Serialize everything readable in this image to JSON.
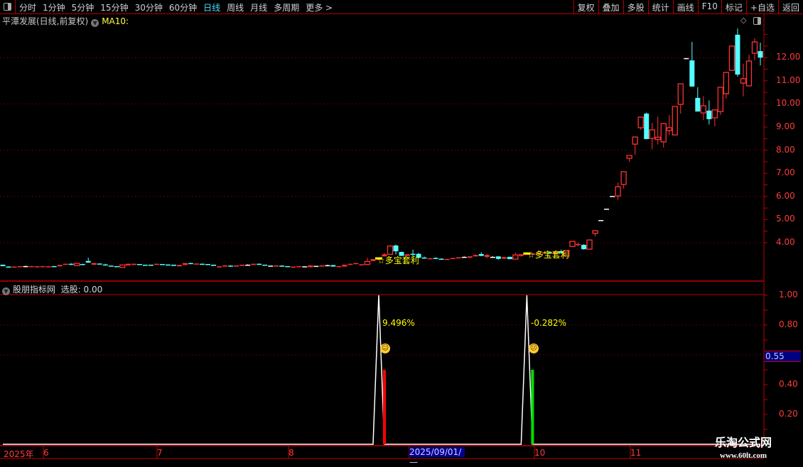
{
  "toolbar": {
    "periods": [
      "分时",
      "1分钟",
      "5分钟",
      "15分钟",
      "30分钟",
      "60分钟",
      "日线",
      "周线",
      "月线",
      "多周期",
      "更多 >"
    ],
    "active_period": "日线",
    "right_buttons": [
      "复权",
      "叠加",
      "多股",
      "统计",
      "画线",
      "F10",
      "标记",
      "+自选",
      "返回"
    ]
  },
  "main": {
    "title": "平潭发展(日线,前复权)",
    "ma_label": "MA10:",
    "price_labels": [
      "12.00",
      "11.00",
      "10.00",
      "9.00",
      "8.00",
      "7.00",
      "6.00",
      "5.00",
      "4.00"
    ],
    "annotations": [
      "☆多宝套利",
      "☆多宝套利"
    ]
  },
  "indicator": {
    "name": "股朋指标网",
    "select_label": "选股: 0.00",
    "axis_labels": [
      "1.00",
      "0.80",
      "0.40",
      "0.20"
    ],
    "cursor_value": "0.55",
    "pct_labels": [
      "9.496%",
      "-0.282%"
    ],
    "signals": [
      {
        "index": 66,
        "bar_index": 67,
        "bar_value": 0.5,
        "color": "#ff0000",
        "mood": "happy"
      },
      {
        "index": 92,
        "bar_index": 93,
        "bar_value": 0.5,
        "color": "#00e000",
        "mood": "sad"
      }
    ]
  },
  "date_axis": {
    "labels": [
      "2025年",
      "6",
      "7",
      "8",
      "10",
      "11"
    ],
    "cursor_date": "2025/09/01/—"
  },
  "watermark": {
    "name": "乐淘公式网",
    "url": "www.60lt.com"
  },
  "colors": {
    "up": "#ff3232",
    "down": "#54ffff",
    "flat": "#ffffff",
    "axis": "#c00000",
    "annotation": "#ffff00"
  },
  "chart_data": {
    "type": "candlestick",
    "ylim": [
      2.8,
      13.3
    ],
    "ohlc_format": "open,close,high,low",
    "candles": [
      [
        3.05,
        2.99,
        3.06,
        2.98
      ],
      [
        2.97,
        2.96,
        2.98,
        2.95
      ],
      [
        2.93,
        2.97,
        2.97,
        2.93
      ],
      [
        2.95,
        2.99,
        2.99,
        2.95
      ],
      [
        2.99,
        2.99,
        3.01,
        2.98
      ],
      [
        2.95,
        2.99,
        2.99,
        2.95
      ],
      [
        2.97,
        2.98,
        2.98,
        2.97
      ],
      [
        2.95,
        2.99,
        2.99,
        2.95
      ],
      [
        2.97,
        2.98,
        2.98,
        2.97
      ],
      [
        2.99,
        2.98,
        2.99,
        2.98
      ],
      [
        2.98,
        3.04,
        3.04,
        2.98
      ],
      [
        3.05,
        3.09,
        3.09,
        3.05
      ],
      [
        3.09,
        3.05,
        3.11,
        3.03
      ],
      [
        3.01,
        3.11,
        3.11,
        3.01
      ],
      [
        3.08,
        3.07,
        3.09,
        3.07
      ],
      [
        3.21,
        3.14,
        3.35,
        3.14
      ],
      [
        3.05,
        3.12,
        3.12,
        3.05
      ],
      [
        3.1,
        3.08,
        3.1,
        3.08
      ],
      [
        3.06,
        3.05,
        3.09,
        3.02
      ],
      [
        3.01,
        3.0,
        3.01,
        3.0
      ],
      [
        2.99,
        2.98,
        2.99,
        2.98
      ],
      [
        2.93,
        3.04,
        3.04,
        2.93
      ],
      [
        3.02,
        3.09,
        3.09,
        3.02
      ],
      [
        3.04,
        3.09,
        3.09,
        3.04
      ],
      [
        3.08,
        3.07,
        3.08,
        3.07
      ],
      [
        3.05,
        3.04,
        3.05,
        3.04
      ],
      [
        3.05,
        3.04,
        3.05,
        3.04
      ],
      [
        3.05,
        3.09,
        3.09,
        3.05
      ],
      [
        3.08,
        3.07,
        3.08,
        3.07
      ],
      [
        3.06,
        3.05,
        3.06,
        3.05
      ],
      [
        3.05,
        3.0,
        3.05,
        3.0
      ],
      [
        2.98,
        3.04,
        3.04,
        2.98
      ],
      [
        3.04,
        3.12,
        3.12,
        3.04
      ],
      [
        3.12,
        3.11,
        3.14,
        3.1
      ],
      [
        3.06,
        3.1,
        3.1,
        3.06
      ],
      [
        3.09,
        3.08,
        3.1,
        3.06
      ],
      [
        3.08,
        3.07,
        3.08,
        3.07
      ],
      [
        3.05,
        3.0,
        3.05,
        3.0
      ],
      [
        2.97,
        2.98,
        2.98,
        2.97
      ],
      [
        2.97,
        3.02,
        3.02,
        2.97
      ],
      [
        3.01,
        3.0,
        3.03,
        3.0
      ],
      [
        2.97,
        3.02,
        3.02,
        2.97
      ],
      [
        3.0,
        3.05,
        3.05,
        3.0
      ],
      [
        3.05,
        3.05,
        3.07,
        3.04
      ],
      [
        3.04,
        3.09,
        3.09,
        3.04
      ],
      [
        3.09,
        3.08,
        3.1,
        3.06
      ],
      [
        3.05,
        3.04,
        3.05,
        3.04
      ],
      [
        3.01,
        3.01,
        3.01,
        3.01
      ],
      [
        2.97,
        3.02,
        3.02,
        2.97
      ],
      [
        3.01,
        3.0,
        3.03,
        3.0
      ],
      [
        2.99,
        2.98,
        2.99,
        2.98
      ],
      [
        2.96,
        2.97,
        2.97,
        2.96
      ],
      [
        2.95,
        2.99,
        2.99,
        2.95
      ],
      [
        2.98,
        2.98,
        2.98,
        2.98
      ],
      [
        2.94,
        3.02,
        3.02,
        2.94
      ],
      [
        3.0,
        3.0,
        3.0,
        3.0
      ],
      [
        2.97,
        3.02,
        3.02,
        2.97
      ],
      [
        3.03,
        3.03,
        3.05,
        3.02
      ],
      [
        3.03,
        2.97,
        3.05,
        2.97
      ],
      [
        2.95,
        2.99,
        2.99,
        2.95
      ],
      [
        2.97,
        3.05,
        3.05,
        2.97
      ],
      [
        3.05,
        3.09,
        3.09,
        3.05
      ],
      [
        3.08,
        3.12,
        3.12,
        3.08
      ],
      [
        3.04,
        3.07,
        3.07,
        3.04
      ],
      [
        3.06,
        3.19,
        3.35,
        3.06
      ],
      [
        3.21,
        3.29,
        3.29,
        3.21
      ],
      [
        3.28,
        3.31,
        3.32,
        3.27
      ],
      [
        3.41,
        3.5,
        3.56,
        3.41
      ],
      [
        3.5,
        3.86,
        3.86,
        3.5
      ],
      [
        3.88,
        3.63,
        3.92,
        3.49
      ],
      [
        3.6,
        3.43,
        3.62,
        3.43
      ],
      [
        3.43,
        3.5,
        3.5,
        3.43
      ],
      [
        3.52,
        3.5,
        3.7,
        3.4
      ],
      [
        3.52,
        3.35,
        3.56,
        3.33
      ],
      [
        3.36,
        3.35,
        3.4,
        3.31
      ],
      [
        3.32,
        3.33,
        3.34,
        3.3
      ],
      [
        3.34,
        3.33,
        3.37,
        3.3
      ],
      [
        3.31,
        3.28,
        3.32,
        3.26
      ],
      [
        3.27,
        3.3,
        3.3,
        3.27
      ],
      [
        3.31,
        3.34,
        3.34,
        3.31
      ],
      [
        3.35,
        3.37,
        3.38,
        3.35
      ],
      [
        3.39,
        3.39,
        3.41,
        3.37
      ],
      [
        3.35,
        3.41,
        3.41,
        3.35
      ],
      [
        3.41,
        3.47,
        3.49,
        3.41
      ],
      [
        3.51,
        3.43,
        3.59,
        3.42
      ],
      [
        3.39,
        3.47,
        3.51,
        3.33
      ],
      [
        3.39,
        3.39,
        3.42,
        3.36
      ],
      [
        3.41,
        3.3,
        3.41,
        3.27
      ],
      [
        3.31,
        3.38,
        3.38,
        3.31
      ],
      [
        3.39,
        3.29,
        3.39,
        3.29
      ],
      [
        3.29,
        3.47,
        3.57,
        3.29
      ],
      [
        3.43,
        3.5,
        3.5,
        3.4
      ],
      [
        3.48,
        3.52,
        3.53,
        3.47
      ],
      [
        3.5,
        3.53,
        3.55,
        3.49
      ],
      [
        3.52,
        3.56,
        3.57,
        3.5
      ],
      [
        3.55,
        3.58,
        3.6,
        3.53
      ],
      [
        3.58,
        3.57,
        3.62,
        3.55
      ],
      [
        3.52,
        3.6,
        3.62,
        3.5
      ],
      [
        3.63,
        3.56,
        3.7,
        3.54
      ],
      [
        3.42,
        3.67,
        3.67,
        3.42
      ],
      [
        3.84,
        4.06,
        4.06,
        3.84
      ],
      [
        3.92,
        3.94,
        4.02,
        3.85
      ],
      [
        3.91,
        3.72,
        3.93,
        3.7
      ],
      [
        3.72,
        4.12,
        4.12,
        3.7
      ],
      [
        4.4,
        4.52,
        4.52,
        4.27
      ],
      [
        4.98,
        4.98,
        4.98,
        4.98
      ],
      [
        5.47,
        5.47,
        5.47,
        5.47
      ],
      [
        6.02,
        6.02,
        6.02,
        6.02
      ],
      [
        6.02,
        6.42,
        6.6,
        5.86
      ],
      [
        6.52,
        7.07,
        7.07,
        6.34
      ],
      [
        7.65,
        7.77,
        7.77,
        7.49
      ],
      [
        8.26,
        8.57,
        8.57,
        7.8
      ],
      [
        8.97,
        9.43,
        9.43,
        8.88
      ],
      [
        9.58,
        8.48,
        9.62,
        8.48
      ],
      [
        8.51,
        8.88,
        9.18,
        8.04
      ],
      [
        8.46,
        8.56,
        9.45,
        8.25
      ],
      [
        8.36,
        9.15,
        9.15,
        8.11
      ],
      [
        8.85,
        8.97,
        9.52,
        8.66
      ],
      [
        8.66,
        9.89,
        9.89,
        8.66
      ],
      [
        9.98,
        10.87,
        10.87,
        9.58
      ],
      [
        11.98,
        11.98,
        11.98,
        11.98
      ],
      [
        11.88,
        10.75,
        12.68,
        10.75
      ],
      [
        10.26,
        9.67,
        10.72,
        9.67
      ],
      [
        9.61,
        9.92,
        10.33,
        9.3
      ],
      [
        9.71,
        9.34,
        10.15,
        9.11
      ],
      [
        9.4,
        9.74,
        9.74,
        9.03
      ],
      [
        9.67,
        10.72,
        10.72,
        9.52
      ],
      [
        10.44,
        11.36,
        11.39,
        10.23
      ],
      [
        11.45,
        12.5,
        12.5,
        11.45
      ],
      [
        12.99,
        11.27,
        13.26,
        11.18
      ],
      [
        10.9,
        11.09,
        11.74,
        10.33
      ],
      [
        10.78,
        11.85,
        12.13,
        10.78
      ],
      [
        12.19,
        12.68,
        12.84,
        11.88
      ],
      [
        12.28,
        12.0,
        12.65,
        11.66
      ]
    ],
    "gridlines": [
      12,
      10,
      8,
      6,
      4
    ]
  }
}
